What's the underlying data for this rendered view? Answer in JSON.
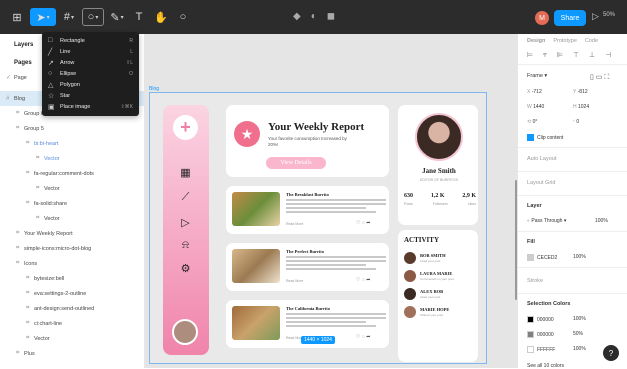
{
  "toolbar": {
    "share_label": "Share",
    "user_initial": "M",
    "zoom_label": "50%"
  },
  "dropdown": {
    "items": [
      {
        "label": "Rectangle",
        "shortcut": "R",
        "icon": "rectangle-icon"
      },
      {
        "label": "Line",
        "shortcut": "L",
        "icon": "line-icon"
      },
      {
        "label": "Arrow",
        "shortcut": "⇧L",
        "icon": "arrow-icon"
      },
      {
        "label": "Ellipse",
        "shortcut": "O",
        "icon": "ellipse-icon"
      },
      {
        "label": "Polygon",
        "shortcut": "",
        "icon": "polygon-icon"
      },
      {
        "label": "Star",
        "shortcut": "",
        "icon": "star-icon"
      },
      {
        "label": "Place image",
        "shortcut": "⇧⌘K",
        "icon": "image-icon"
      }
    ]
  },
  "left_panel": {
    "tab_layers": "Layers",
    "pages_header": "Pages",
    "page_item": "Page",
    "layers": [
      {
        "label": "Blog",
        "indent": 0,
        "selected": true,
        "blue": false
      },
      {
        "label": "Group 6",
        "indent": 1,
        "selected": false,
        "blue": false
      },
      {
        "label": "Group 5",
        "indent": 1,
        "selected": false,
        "blue": false
      },
      {
        "label": "bi:bi-heart",
        "indent": 2,
        "selected": false,
        "blue": true
      },
      {
        "label": "Vector",
        "indent": 3,
        "selected": false,
        "blue": true
      },
      {
        "label": "fa-regular:comment-dots",
        "indent": 2,
        "selected": false,
        "blue": false
      },
      {
        "label": "Vector",
        "indent": 3,
        "selected": false,
        "blue": false
      },
      {
        "label": "fa-solid:share",
        "indent": 2,
        "selected": false,
        "blue": false
      },
      {
        "label": "Vector",
        "indent": 3,
        "selected": false,
        "blue": false
      },
      {
        "label": "Your Weekly Report",
        "indent": 1,
        "selected": false,
        "blue": false
      },
      {
        "label": "simple-icons:micro-dot-blog",
        "indent": 1,
        "selected": false,
        "blue": false
      },
      {
        "label": "Icons",
        "indent": 1,
        "selected": false,
        "blue": false
      },
      {
        "label": "bytesize:bell",
        "indent": 2,
        "selected": false,
        "blue": false
      },
      {
        "label": "eva:settings-2-outline",
        "indent": 2,
        "selected": false,
        "blue": false
      },
      {
        "label": "ant-design:send-outlined",
        "indent": 2,
        "selected": false,
        "blue": false
      },
      {
        "label": "ci:chart-line",
        "indent": 2,
        "selected": false,
        "blue": false
      },
      {
        "label": "Vector",
        "indent": 2,
        "selected": false,
        "blue": false
      },
      {
        "label": "Plus",
        "indent": 1,
        "selected": false,
        "blue": false
      }
    ]
  },
  "canvas": {
    "frame_label": "Blog",
    "dimension_badge": "1440 × 1024",
    "report": {
      "title": "Your Weekly Report",
      "subtitle": "Your favorite consumption Increased by 20%!",
      "button": "View Details"
    },
    "posts": [
      {
        "title": "The Breakfast Burrito",
        "foot": "Read More"
      },
      {
        "title": "The Perfect Burrito",
        "foot": "Read More"
      },
      {
        "title": "The California Burrito",
        "foot": "Read More"
      }
    ],
    "profile": {
      "name": "Jane Smith",
      "role": "EDITOR OF BURRITOS",
      "stats": [
        {
          "value": "630",
          "label": "Posts"
        },
        {
          "value": "1,2 K",
          "label": "Followers"
        },
        {
          "value": "2,9 K",
          "label": "Likes"
        }
      ]
    },
    "activity": {
      "title": "ACTIVITY",
      "people": [
        {
          "name": "BOB SMITH",
          "sub": "Liked your post"
        },
        {
          "name": "LAURA MARIE",
          "sub": "Commented on your post"
        },
        {
          "name": "ALEX BOB",
          "sub": "Liked your post"
        },
        {
          "name": "MARIE HOPE",
          "sub": "Shared your post"
        }
      ]
    }
  },
  "right_panel": {
    "tabs": [
      "Design",
      "Prototype",
      "Code"
    ],
    "frame_label": "Frame",
    "x": "-712",
    "y": "-812",
    "w": "1440",
    "h": "1024",
    "rotation": "0°",
    "radius": "0",
    "clip_content": "Clip content",
    "auto_layout": "Auto Layout",
    "layout_grid": "Layout Grid",
    "layer_header": "Layer",
    "layer_mode": "Pass Through",
    "layer_opacity": "100%",
    "fill_header": "Fill",
    "fill_color": "CECED2",
    "fill_opacity": "100%",
    "stroke_header": "Stroke",
    "selection_colors": "Selection Colors",
    "colors": [
      {
        "hex": "000000",
        "opacity": "100%",
        "swatch": "#000000"
      },
      {
        "hex": "000000",
        "opacity": "50%",
        "swatch": "#808080"
      },
      {
        "hex": "FFFFFF",
        "opacity": "100%",
        "swatch": "#ffffff"
      }
    ],
    "see_all": "See all 10 colors"
  },
  "colors": {
    "accent": "#0d99ff",
    "pink": "#f07fa7",
    "toolbar_bg": "#2c2c2c"
  }
}
